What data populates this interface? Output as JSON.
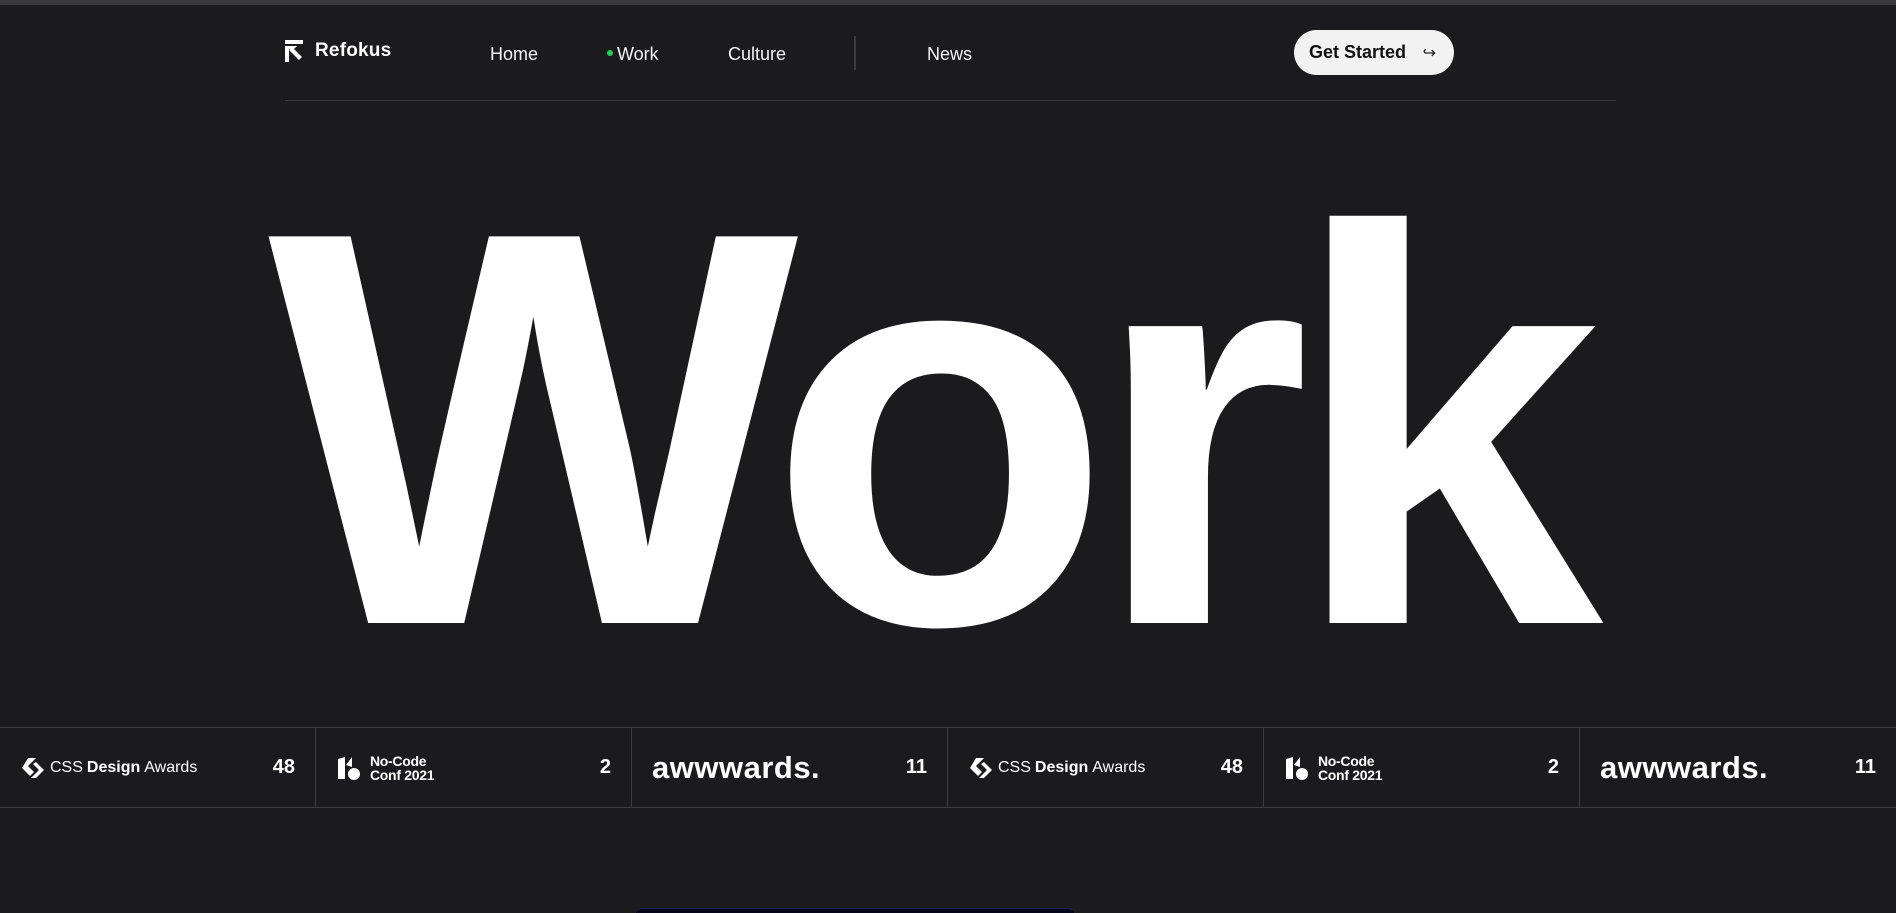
{
  "brand": {
    "name": "Refokus",
    "icon": "refokus-arrow-logo"
  },
  "nav": {
    "items": [
      {
        "label": "Home",
        "active": false
      },
      {
        "label": "Work",
        "active": true
      },
      {
        "label": "Culture",
        "active": false
      },
      {
        "label": "News",
        "active": false
      }
    ],
    "active_indicator_color": "#1fd14c"
  },
  "cta": {
    "label": "Get Started",
    "icon": "arrow-return-icon",
    "arrow_glyph": "↪"
  },
  "hero": {
    "title": "Work"
  },
  "awards": [
    {
      "brand_prefix": "CSS",
      "brand_bold": "Design",
      "brand_suffix": "Awards",
      "icon": "css-design-awards-logo",
      "count": "48"
    },
    {
      "line1": "No-Code",
      "line2": "Conf 2021",
      "icon": "nocode-conf-logo",
      "count": "2"
    },
    {
      "brand": "awwwards.",
      "icon": "awwwards-logo",
      "count": "11"
    },
    {
      "brand_prefix": "CSS",
      "brand_bold": "Design",
      "brand_suffix": "Awards",
      "icon": "css-design-awards-logo",
      "count": "48"
    },
    {
      "line1": "No-Code",
      "line2": "Conf 2021",
      "icon": "nocode-conf-logo",
      "count": "2"
    },
    {
      "brand": "awwwards.",
      "icon": "awwwards-logo",
      "count": "11"
    }
  ],
  "colors": {
    "background": "#1b1b1d",
    "text": "#ffffff",
    "cta_bg": "#f2f2f2",
    "divider": "#3c3c3f"
  }
}
